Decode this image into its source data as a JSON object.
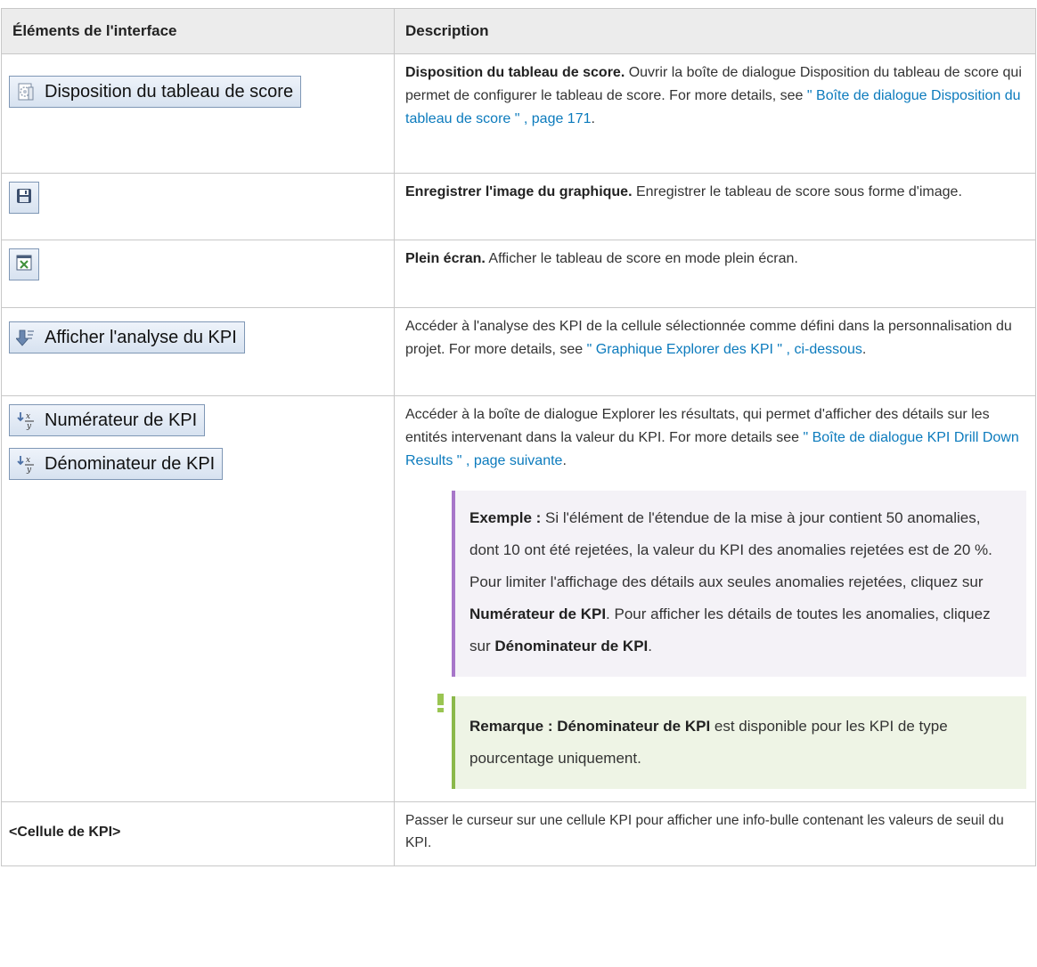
{
  "header": {
    "col1": "Éléments de l'interface",
    "col2": "Description"
  },
  "rows": {
    "layout": {
      "button_label": "Disposition du tableau de score",
      "icon": "scorecard-layout-icon",
      "title": "Disposition du tableau de score.",
      "text": " Ouvrir la boîte de dialogue Disposition du tableau de score qui permet de configurer le tableau de score. For more details, see ",
      "link": "\" Boîte de dialogue Disposition du tableau de score \" , page 171",
      "end": "."
    },
    "save": {
      "icon": "save-icon",
      "title": "Enregistrer l'image du graphique.",
      "text": " Enregistrer le tableau de score sous forme d'image."
    },
    "fullscreen": {
      "icon": "fullscreen-icon",
      "title": "Plein écran.",
      "text": "  Afficher le tableau de score en mode plein écran."
    },
    "analysis": {
      "button_label": "Afficher l'analyse du KPI",
      "icon": "drill-down-icon",
      "text": "Accéder à l'analyse des KPI de la cellule sélectionnée comme défini dans la personnalisation du projet. For more details, see ",
      "link": "\" Graphique Explorer des KPI \" , ci-dessous",
      "end": "."
    },
    "numden": {
      "numerator_label": "Numérateur de KPI",
      "denominator_label": "Dénominateur de KPI",
      "icon": "fx-icon",
      "text": "Accéder à la boîte de dialogue Explorer les résultats, qui permet d'afficher des détails sur les entités intervenant dans la valeur du KPI. For more details see ",
      "link": "\" Boîte de dialogue KPI Drill Down Results \" , page suivante",
      "end": ".",
      "example": {
        "lead": "Exemple :",
        "t1": " Si l'élément de l'étendue de la mise à jour contient 50 anomalies, dont 10 ont été rejetées, la valeur du KPI des anomalies rejetées est de 20 %. Pour limiter l'affichage des détails aux seules anomalies rejetées, cliquez sur ",
        "b1": "Numérateur de KPI",
        "t2": ". Pour afficher les détails de toutes les anomalies, cliquez sur ",
        "b2": "Dénominateur de KPI",
        "t3": "."
      },
      "note": {
        "lead": "Remarque : Dénominateur de KPI",
        "text": " est disponible pour les KPI de type pourcentage uniquement."
      }
    },
    "cell": {
      "label": "<Cellule de KPI>",
      "text": "Passer le curseur sur une cellule KPI pour afficher une info-bulle contenant les valeurs de seuil du KPI."
    }
  }
}
